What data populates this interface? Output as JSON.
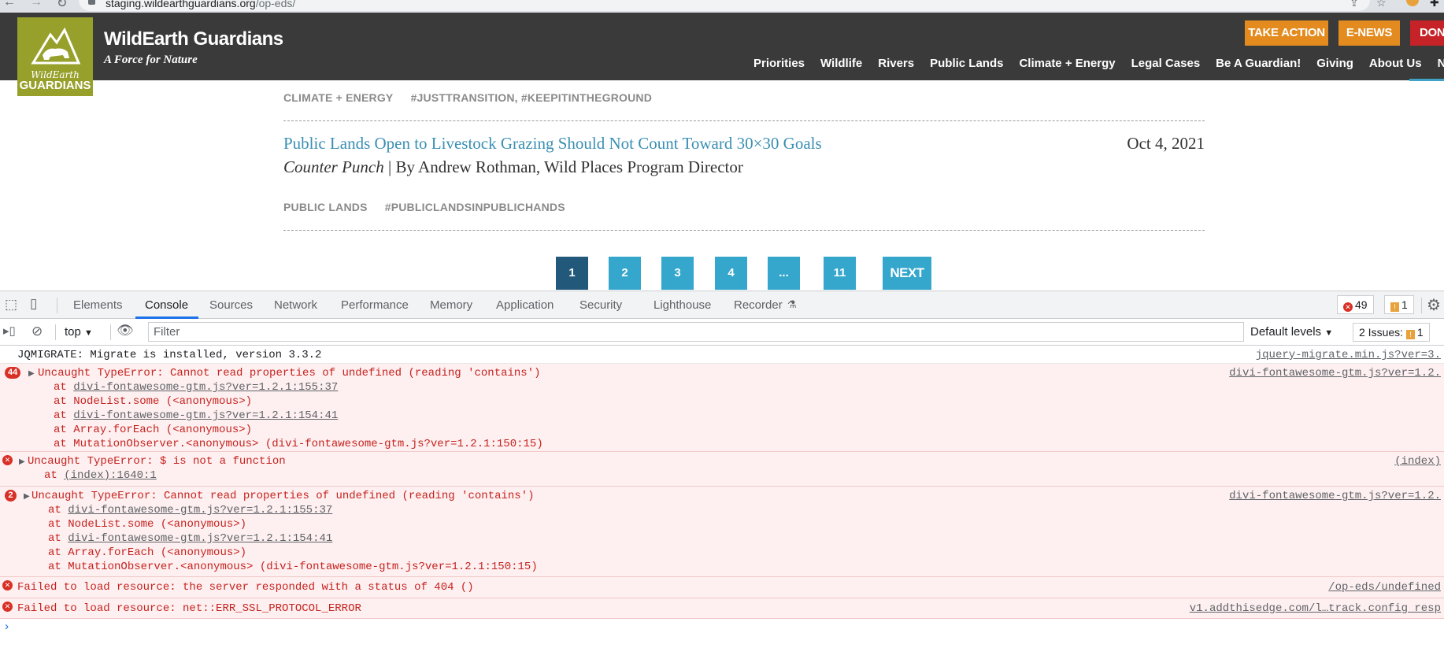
{
  "browser": {
    "url_host": "staging.wildearthguardians.org",
    "url_path": "/op-eds/"
  },
  "site": {
    "logo_word1": "WildEarth",
    "logo_word2": "GUARDIANS",
    "title": "WildEarth Guardians",
    "tagline": "A Force for Nature",
    "cta_take_action": "TAKE ACTION",
    "cta_enews": "E-NEWS",
    "cta_donate": "DONA",
    "nav": [
      "Priorities",
      "Wildlife",
      "Rivers",
      "Public Lands",
      "Climate + Energy",
      "Legal Cases",
      "Be A Guardian!",
      "Giving",
      "About Us",
      "Newsr"
    ]
  },
  "content": {
    "tags1": [
      "CLIMATE + ENERGY",
      "#JUSTTRANSITION, #KEEPITINTHEGROUND"
    ],
    "article_title": "Public Lands Open to Livestock Grazing Should Not Count Toward 30×30 Goals",
    "article_date": "Oct 4, 2021",
    "article_publication": "Counter Punch",
    "article_byline_rest": " | By Andrew Rothman, Wild Places Program Director",
    "tags2": [
      "PUBLIC LANDS",
      "#PUBLICLANDSINPUBLICHANDS"
    ],
    "pagination": [
      "1",
      "2",
      "3",
      "4",
      "...",
      "11"
    ],
    "pagination_next": "NEXT"
  },
  "devtools": {
    "tabs": [
      "Elements",
      "Console",
      "Sources",
      "Network",
      "Performance",
      "Memory",
      "Application",
      "Security",
      "Lighthouse",
      "Recorder"
    ],
    "active_tab": "Console",
    "error_count": "49",
    "warning_count": "1",
    "context": "top",
    "filter_placeholder": "Filter",
    "default_levels": "Default levels",
    "issues_label": "2 Issues:",
    "issues_warn": "1",
    "messages": [
      {
        "type": "info",
        "text": "JQMIGRATE: Migrate is installed, version 3.3.2",
        "source": "jquery-migrate.min.js?ver=3."
      },
      {
        "type": "error",
        "count": "44",
        "text": "Uncaught TypeError: Cannot read properties of undefined (reading 'contains')",
        "source": "divi-fontawesome-gtm.js?ver=1.2.",
        "stack": [
          "divi-fontawesome-gtm.js?ver=1.2.1:155:37",
          "NodeList.some (<anonymous>)",
          "divi-fontawesome-gtm.js?ver=1.2.1:154:41",
          "Array.forEach (<anonymous>)",
          "MutationObserver.<anonymous> (divi-fontawesome-gtm.js?ver=1.2.1:150:15)"
        ]
      },
      {
        "type": "error",
        "text": "Uncaught TypeError: $ is not a function",
        "source": "(index)",
        "stack": [
          "(index):1640:1"
        ]
      },
      {
        "type": "error",
        "count": "2",
        "text": "Uncaught TypeError: Cannot read properties of undefined (reading 'contains')",
        "source": "divi-fontawesome-gtm.js?ver=1.2.",
        "stack": [
          "divi-fontawesome-gtm.js?ver=1.2.1:155:37",
          "NodeList.some (<anonymous>)",
          "divi-fontawesome-gtm.js?ver=1.2.1:154:41",
          "Array.forEach (<anonymous>)",
          "MutationObserver.<anonymous> (divi-fontawesome-gtm.js?ver=1.2.1:150:15)"
        ]
      },
      {
        "type": "error",
        "text": "Failed to load resource: the server responded with a status of 404 ()",
        "source": "/op-eds/undefined"
      },
      {
        "type": "error",
        "text": "Failed to load resource: net::ERR_SSL_PROTOCOL_ERROR",
        "source": "v1.addthisedge.com/l…track.config_resp"
      }
    ]
  }
}
